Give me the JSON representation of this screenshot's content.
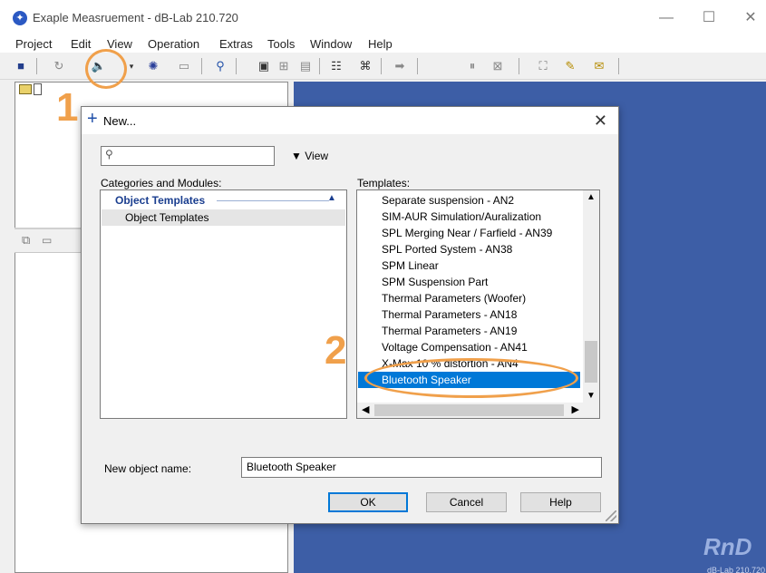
{
  "window": {
    "title": "Exaple Measruement - dB-Lab 210.720",
    "controls": {
      "minimize": "—",
      "maximize": "☐",
      "close": "✕"
    }
  },
  "menu": [
    "Project",
    "Edit",
    "View",
    "Operation",
    "Extras",
    "Tools",
    "Window",
    "Help"
  ],
  "workspace": {
    "logo": "RnD",
    "version": "dB-Lab 210.720"
  },
  "dialog": {
    "title": "New...",
    "close": "✕",
    "search_value": "",
    "view_label": "View",
    "categories_label": "Categories and Modules:",
    "templates_label": "Templates:",
    "categories": {
      "group": "Object Templates",
      "items": [
        "Object Templates"
      ]
    },
    "templates": [
      "Separate suspension - AN2",
      "SIM-AUR Simulation/Auralization",
      "SPL Merging Near / Farfield - AN39",
      "SPL Ported System - AN38",
      "SPM Linear",
      "SPM Suspension Part",
      "Thermal Parameters (Woofer)",
      "Thermal Parameters - AN18",
      "Thermal Parameters - AN19",
      "Voltage Compensation - AN41",
      "X-Max 10 % distortion - AN4",
      "Bluetooth Speaker"
    ],
    "selected_template": "Bluetooth Speaker",
    "object_name_label": "New object name:",
    "object_name_value": "Bluetooth Speaker",
    "buttons": {
      "ok": "OK",
      "cancel": "Cancel",
      "help": "Help"
    }
  },
  "annotations": {
    "step1": "1",
    "step2": "2",
    "color": "#f0a04b"
  },
  "colors": {
    "workspace": "#3d5ea6",
    "selection": "#0078d7",
    "category_text": "#1a3e8f"
  }
}
